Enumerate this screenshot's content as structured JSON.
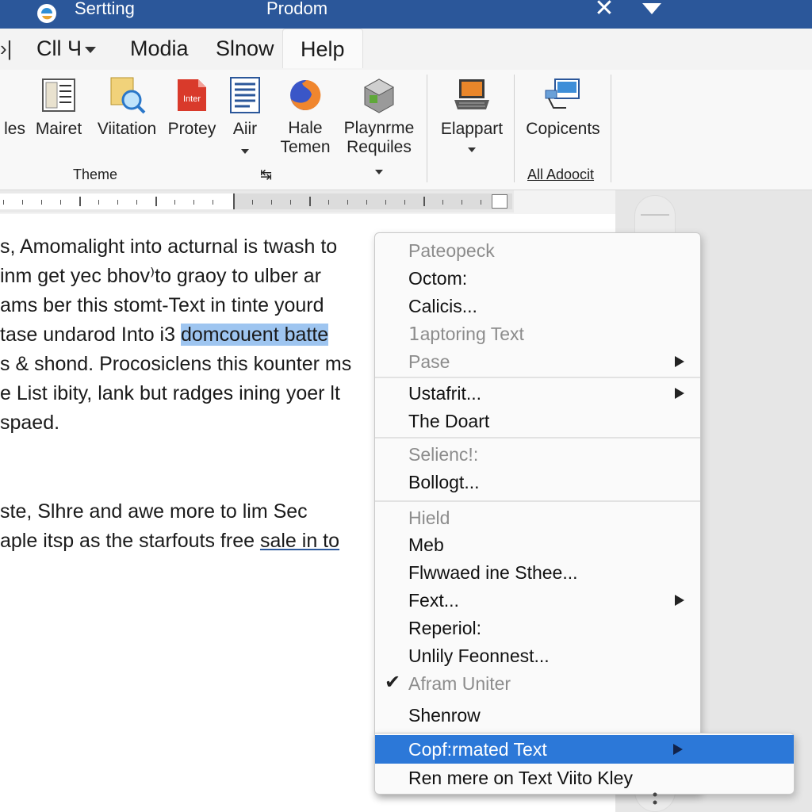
{
  "window": {
    "app_title": "Sertting",
    "doc_title": "Prodom",
    "close_glyph": "✕",
    "logo_icon": "app-logo-icon"
  },
  "menubar": {
    "edge_glyph": "›|",
    "tabs": [
      {
        "label": "Cll Ч",
        "has_caret": true
      },
      {
        "label": "Modia"
      },
      {
        "label": "Slnow"
      },
      {
        "label": "Help",
        "active": true
      }
    ]
  },
  "ribbon": {
    "buttons": [
      {
        "label": "les",
        "icon": "styles-icon"
      },
      {
        "label": "Mairet",
        "icon": "document-icon"
      },
      {
        "label": "Viitation",
        "icon": "search-document-icon"
      },
      {
        "label": "Protey",
        "icon": "pdf-icon",
        "icon_text": "Inter"
      },
      {
        "label": "Aiir",
        "icon": "text-page-icon"
      },
      {
        "label": "Hale\nTemen",
        "icon": "firefox-icon"
      },
      {
        "label": "Playnrme\nRequiles",
        "icon": "box-icon"
      },
      {
        "label": "Elappart",
        "icon": "laptop-icon"
      },
      {
        "label": "Copicents",
        "icon": "monitor-icon"
      }
    ],
    "groups": [
      {
        "label": "Theme"
      },
      {
        "label": "↹"
      },
      {
        "label": "All Adoocit"
      }
    ]
  },
  "document": {
    "lines": [
      {
        "text": "s, Amomalight into acturnal is twash to"
      },
      {
        "text": "inm get yec bhov⁾to graoy to ulber ar"
      },
      {
        "text": "ams ber this stomt-Text in tinte yourd"
      },
      {
        "before": "tase undarod Into i3 ",
        "selected": "domcouent batte"
      },
      {
        "text": "s & shond. Procosiclens this kounter ms"
      },
      {
        "text": "e List ibity, lank but radges ining yoer lt"
      },
      {
        "text": "spaed."
      },
      {
        "text": "ste,  Slhre  and  awe  more  to lim  Sec"
      },
      {
        "before": "aple itsp as the starfouts free ",
        "linked": "sale in to"
      }
    ]
  },
  "context_menu": {
    "items": [
      {
        "label": "Pateopeck",
        "disabled": true
      },
      {
        "label": "Octom:"
      },
      {
        "label": "Calicis..."
      },
      {
        "label": "𝟣aptoring Text",
        "disabled": true
      },
      {
        "label": "Pase",
        "disabled": true,
        "submenu": true
      },
      {
        "label": "Ustafrit...",
        "submenu": true
      },
      {
        "label": "The Doart"
      },
      {
        "label": "Selienc!:",
        "disabled": true
      },
      {
        "label": "Bollogt..."
      },
      {
        "label": "Hield",
        "disabled": true
      },
      {
        "label": "Meb"
      },
      {
        "label": "Flwwaed ine Sthee..."
      },
      {
        "label": "Fext...",
        "submenu": true
      },
      {
        "label": "Reperiol:"
      },
      {
        "label": "Unlily Feonnest..."
      },
      {
        "label": "Afram Uniter",
        "disabled": true,
        "checked": true
      },
      {
        "label": "Shenrow"
      }
    ],
    "highlighted": {
      "label": "Copf:rmated Text",
      "submenu": true
    },
    "last": {
      "label": "Ren mere on Text Viito Kley"
    },
    "check_glyph": "✔",
    "highlight_color": "#2c78d8"
  },
  "colors": {
    "titlebar": "#2b579a",
    "selection": "#9ec5f0"
  }
}
